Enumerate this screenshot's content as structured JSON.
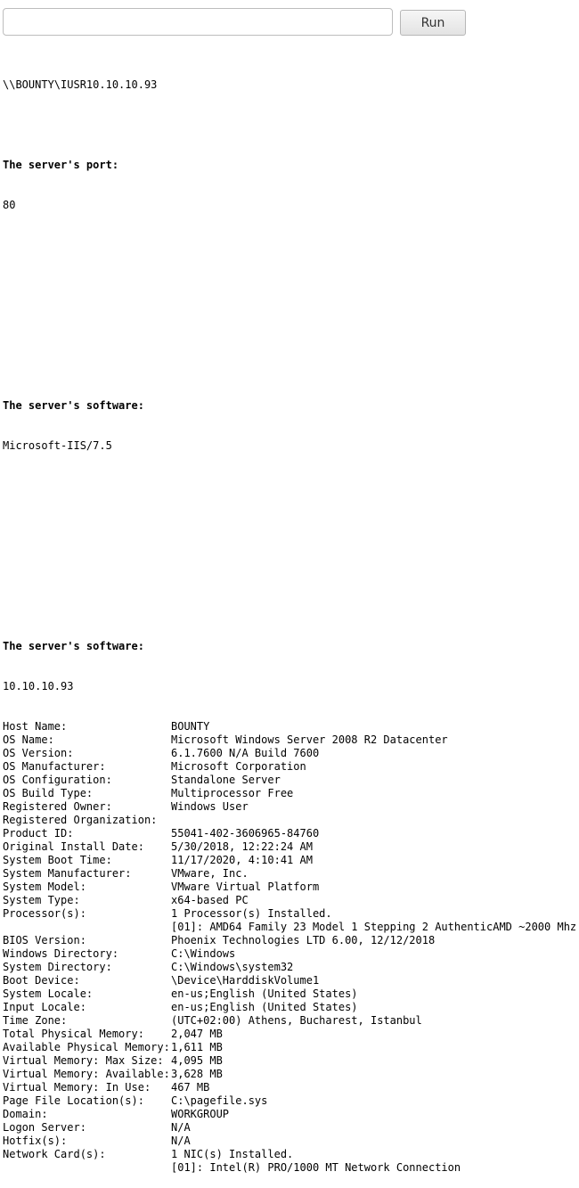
{
  "command": {
    "input_value": "",
    "run_label": "Run"
  },
  "output": {
    "user": "\\\\BOUNTY\\IUSR10.10.10.93",
    "port_heading": "The server's port:",
    "port_value": "80",
    "software_heading": "The server's software:",
    "software_value": "Microsoft-IIS/7.5",
    "software_heading_2": "The server's software:",
    "ip_value": "10.10.10.93",
    "systeminfo": [
      {
        "key": "Host Name:",
        "value": "BOUNTY"
      },
      {
        "key": "OS Name:",
        "value": "Microsoft Windows Server 2008 R2 Datacenter"
      },
      {
        "key": "OS Version:",
        "value": "6.1.7600 N/A Build 7600"
      },
      {
        "key": "OS Manufacturer:",
        "value": "Microsoft Corporation"
      },
      {
        "key": "OS Configuration:",
        "value": "Standalone Server"
      },
      {
        "key": "OS Build Type:",
        "value": "Multiprocessor Free"
      },
      {
        "key": "Registered Owner:",
        "value": "Windows User"
      },
      {
        "key": "Registered Organization:",
        "value": ""
      },
      {
        "key": "Product ID:",
        "value": "55041-402-3606965-84760"
      },
      {
        "key": "Original Install Date:",
        "value": "5/30/2018, 12:22:24 AM"
      },
      {
        "key": "System Boot Time:",
        "value": "11/17/2020, 4:10:41 AM"
      },
      {
        "key": "System Manufacturer:",
        "value": "VMware, Inc."
      },
      {
        "key": "System Model:",
        "value": "VMware Virtual Platform"
      },
      {
        "key": "System Type:",
        "value": "x64-based PC"
      },
      {
        "key": "Processor(s):",
        "value": "1 Processor(s) Installed."
      },
      {
        "key": "",
        "value": "[01]: AMD64 Family 23 Model 1 Stepping 2 AuthenticAMD ~2000 Mhz"
      },
      {
        "key": "BIOS Version:",
        "value": "Phoenix Technologies LTD 6.00, 12/12/2018"
      },
      {
        "key": "Windows Directory:",
        "value": "C:\\Windows"
      },
      {
        "key": "System Directory:",
        "value": "C:\\Windows\\system32"
      },
      {
        "key": "Boot Device:",
        "value": "\\Device\\HarddiskVolume1"
      },
      {
        "key": "System Locale:",
        "value": "en-us;English (United States)"
      },
      {
        "key": "Input Locale:",
        "value": "en-us;English (United States)"
      },
      {
        "key": "Time Zone:",
        "value": "(UTC+02:00) Athens, Bucharest, Istanbul"
      },
      {
        "key": "Total Physical Memory:",
        "value": "2,047 MB"
      },
      {
        "key": "Available Physical Memory:",
        "value": "1,611 MB"
      },
      {
        "key": "Virtual Memory: Max Size:",
        "value": "4,095 MB"
      },
      {
        "key": "Virtual Memory: Available:",
        "value": "3,628 MB"
      },
      {
        "key": "Virtual Memory: In Use:",
        "value": "467 MB"
      },
      {
        "key": "Page File Location(s):",
        "value": "C:\\pagefile.sys"
      },
      {
        "key": "Domain:",
        "value": "WORKGROUP"
      },
      {
        "key": "Logon Server:",
        "value": "N/A"
      },
      {
        "key": "Hotfix(s):",
        "value": "N/A"
      },
      {
        "key": "Network Card(s):",
        "value": "1 NIC(s) Installed."
      },
      {
        "key": "",
        "value": "[01]: Intel(R) PRO/1000 MT Network Connection"
      }
    ]
  }
}
